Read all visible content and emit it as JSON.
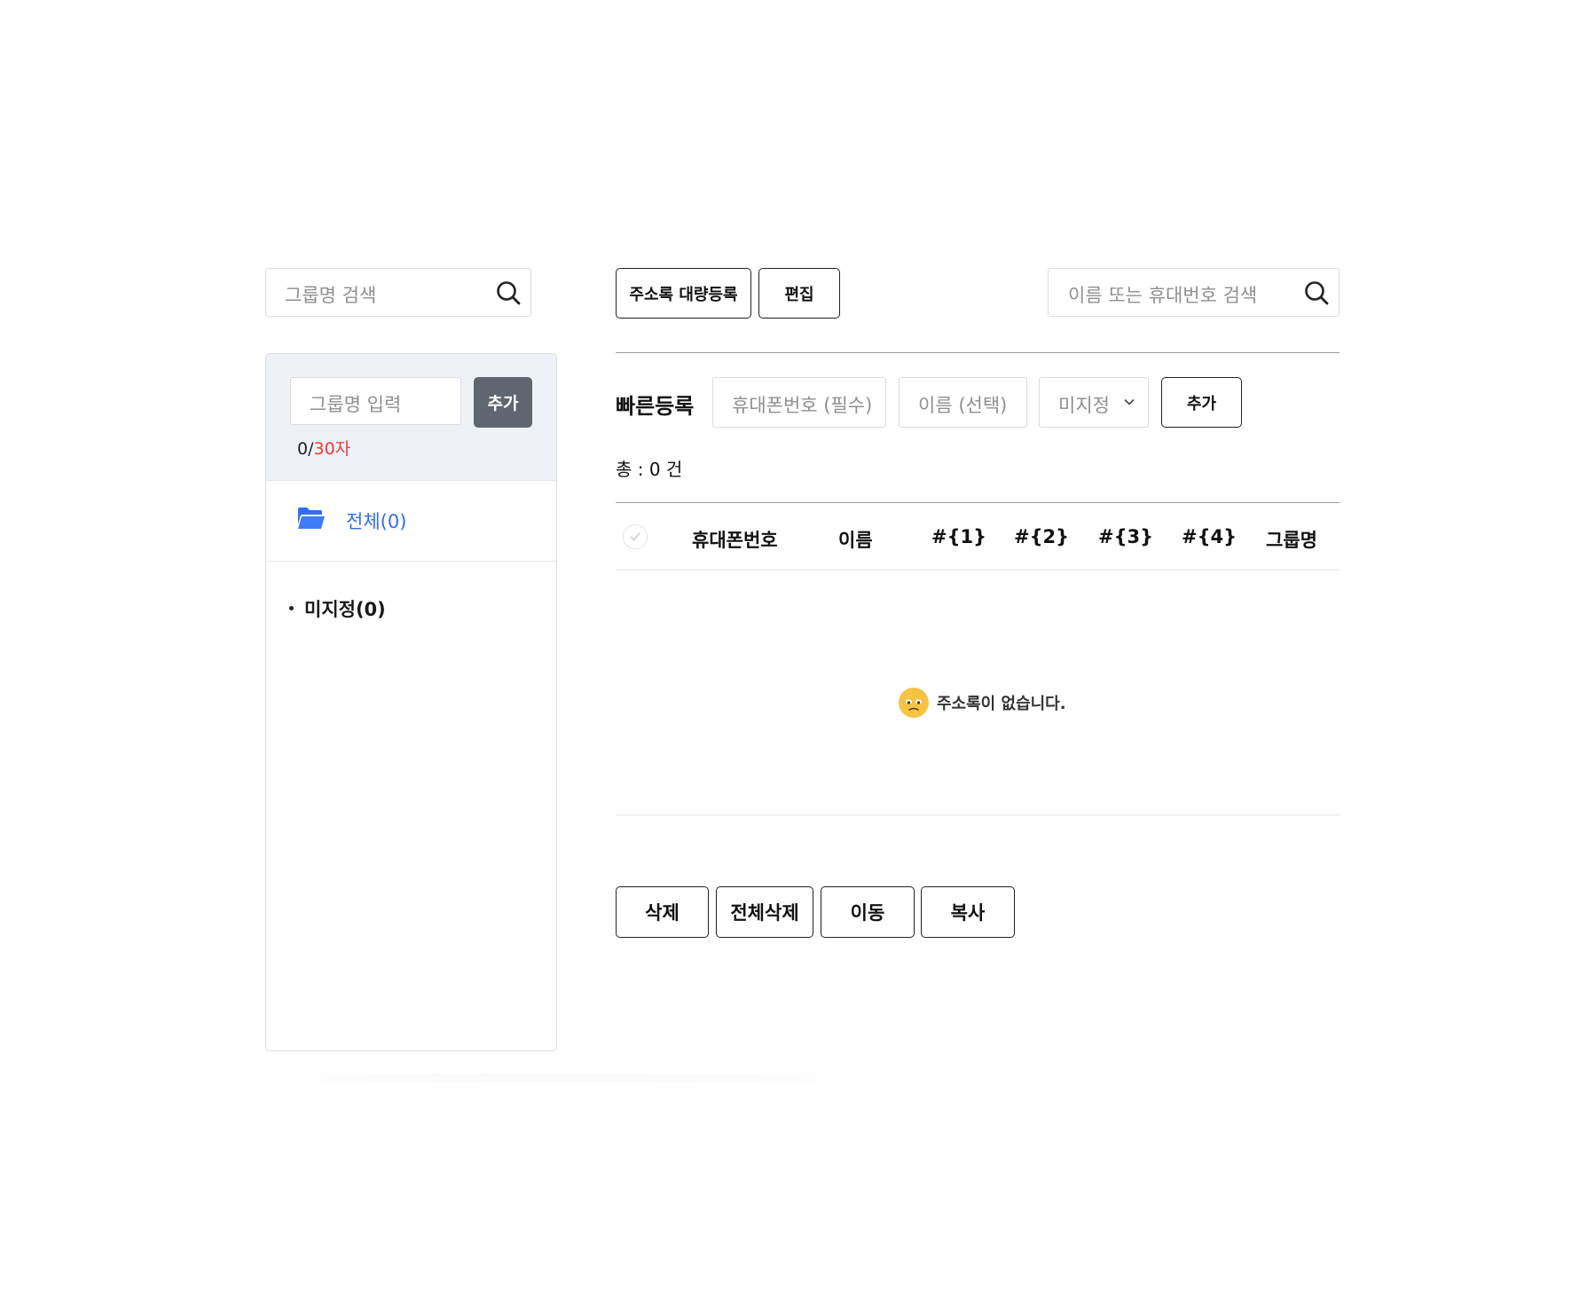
{
  "left": {
    "group_search": {
      "placeholder": "그룹명 검색",
      "icon": "search-icon"
    },
    "group_input": {
      "placeholder": "그룹명 입력"
    },
    "add_button": "추가",
    "char_count": {
      "current": "0/",
      "max": "30자"
    },
    "all_group": {
      "label": "전체(0)",
      "icon": "folder-open-icon"
    },
    "groups": [
      {
        "label": "미지정(0)"
      }
    ]
  },
  "toolbar": {
    "bulk_register": "주소록 대량등록",
    "edit": "편집",
    "search": {
      "placeholder": "이름 또는 휴대번호 검색",
      "icon": "search-icon"
    }
  },
  "quick_register": {
    "label": "빠른등록",
    "phone_placeholder": "휴대폰번호 (필수)",
    "name_placeholder": "이름 (선택)",
    "group_select": "미지정",
    "add_button": "추가"
  },
  "summary": {
    "total": "총 : 0 건"
  },
  "table": {
    "columns": [
      "휴대폰번호",
      "이름",
      "#{1}",
      "#{2}",
      "#{3}",
      "#{4}",
      "그룹명"
    ],
    "empty_message": "주소록이 없습니다."
  },
  "actions": {
    "delete": "삭제",
    "delete_all": "전체삭제",
    "move": "이동",
    "copy": "복사"
  },
  "colors": {
    "accent_blue": "#2f6ef0",
    "limit_red": "#ee3a3a",
    "panel_bg": "#eef1f8",
    "dark_button": "#60666f"
  }
}
